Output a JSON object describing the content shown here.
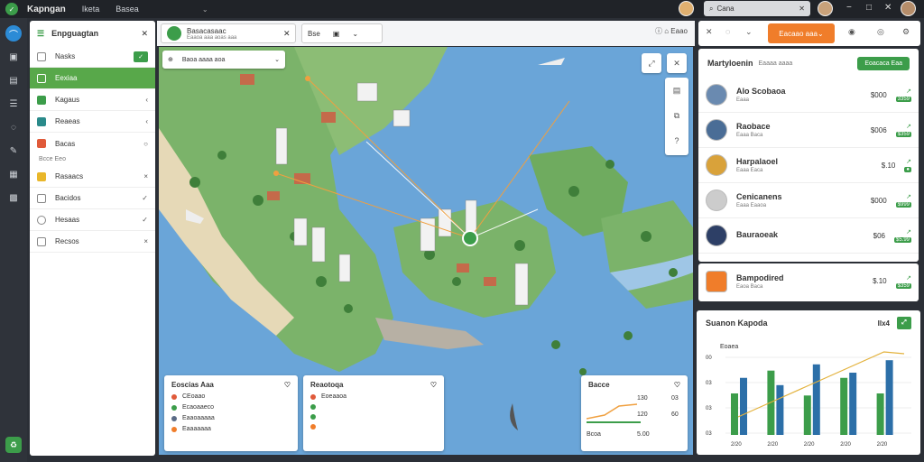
{
  "topbar": {
    "app_name": "Kapngan",
    "menu_item": "Iketa",
    "menu_item2": "Basea",
    "search_placeholder": "Cana"
  },
  "left_panel": {
    "title": "Enpguagtan",
    "rows": [
      {
        "label": "Nasks",
        "control": "✓",
        "active": false,
        "button": true
      },
      {
        "label": "Eexiaa",
        "control": "",
        "active": true
      },
      {
        "label": "Kagaus",
        "control": "‹",
        "active": false
      },
      {
        "label": "Reaeas",
        "control": "‹",
        "active": false
      },
      {
        "label": "Bacas",
        "control": "○",
        "active": false
      }
    ],
    "sub_text": "Bcce Eeo",
    "rows2": [
      {
        "label": "Rasaacs",
        "control": "×"
      },
      {
        "label": "Bacidos",
        "control": "✓"
      },
      {
        "label": "Hesaas",
        "control": "✓"
      },
      {
        "label": "Recsos",
        "control": "×"
      }
    ]
  },
  "map_header": {
    "tab1_title": "Basacasaac",
    "tab1_sub": "Eaaoa aaa aoas aaa",
    "tab2_label": "Bse",
    "tools": "ⓘ  ⌂  Eaao"
  },
  "layer_bar": {
    "label": "Baoa aaaa aoa"
  },
  "map_cards": [
    {
      "title": "Eoscias Aaa",
      "rows": [
        {
          "text": "CEoaao",
          "color": "#e05a3a"
        },
        {
          "text": "Ecaoaaeco",
          "color": "#3c9d4a"
        },
        {
          "text": "Eaaoaaaaa",
          "color": "#5a6b86"
        },
        {
          "text": "Eaaaaaaa",
          "color": "#f07d2a"
        }
      ]
    },
    {
      "title": "Reaotoqa",
      "rows": [
        {
          "text": "Eoeaaoa",
          "color": "#e05a3a"
        },
        {
          "text": "",
          "color": "#3c9d4a"
        },
        {
          "text": "",
          "color": "#3c9d4a"
        },
        {
          "text": "",
          "color": "#f07d2a"
        }
      ]
    },
    {
      "title": "Bacce",
      "rows": [
        {
          "text": "Bcoa",
          "color": "#3c9d4a"
        },
        {
          "text": "Basaa",
          "color": "#3c9d4a"
        }
      ]
    }
  ],
  "map_card3_values": [
    "130",
    "120",
    "Bcoa",
    "5.00",
    "60",
    "03"
  ],
  "right_top": {
    "orange_button": "Eacaao aaa"
  },
  "right_panel": {
    "title": "Martyloenin",
    "subtitle": "Eaaaa aaaa",
    "action": "Eoacaca Eaa",
    "items": [
      {
        "name": "Alo Scobaoa",
        "sub": "Eaaa",
        "price": "$000",
        "trend": "↗",
        "badge": "3359"
      },
      {
        "name": "Raobace",
        "sub": "Eaaa Baca",
        "price": "$006",
        "trend": "↗",
        "badge": "$359"
      },
      {
        "name": "Harpalaoel",
        "sub": "Eaaa Eaca",
        "price": "$.10",
        "trend": "↗",
        "badge": "●"
      },
      {
        "name": "Cenicanens",
        "sub": "Eaaa Eaaoa",
        "price": "$000",
        "trend": "↗",
        "badge": "$999"
      },
      {
        "name": "Bauraoeak",
        "sub": "",
        "price": "$06",
        "trend": "↗",
        "badge": "$5.99"
      },
      {
        "name": "Bampodired",
        "sub": "Eaoa Baca",
        "price": "$.10",
        "trend": "↗",
        "badge": "$359"
      }
    ]
  },
  "right_chart": {
    "title": "Suanon Kapoda",
    "metric": "Ilx4",
    "legend": "Eoaea",
    "chart_data": {
      "type": "bar",
      "categories": [
        "2/20",
        "2/20",
        "2/20",
        "2/20",
        "2/20"
      ],
      "series": [
        {
          "name": "",
          "values": [
            40,
            62,
            38,
            55,
            40
          ]
        },
        {
          "name": "",
          "values": [
            55,
            48,
            68,
            60,
            72
          ]
        }
      ],
      "yticks": [
        "00",
        "03",
        "03",
        "03"
      ]
    }
  },
  "colors": {
    "accent_green": "#3c9d4a",
    "accent_orange": "#f07d2a",
    "rail_active": "#2c8bd6"
  }
}
